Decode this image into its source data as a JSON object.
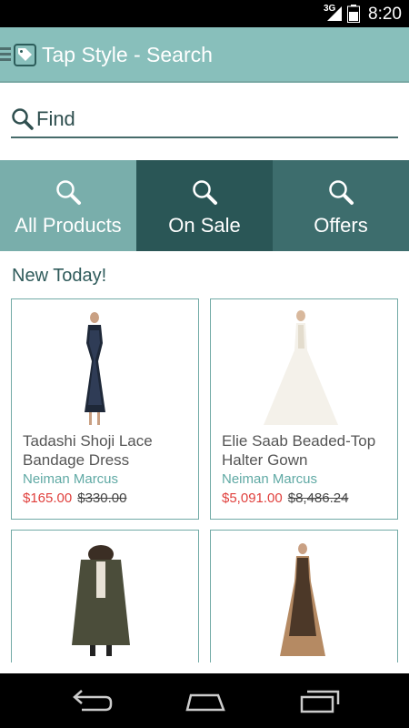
{
  "status_bar": {
    "network": "3G",
    "time": "8:20"
  },
  "app_bar": {
    "title": "Tap Style - Search"
  },
  "search": {
    "placeholder": "Find"
  },
  "tabs": [
    {
      "label": "All Products"
    },
    {
      "label": "On Sale"
    },
    {
      "label": "Offers"
    }
  ],
  "section_title": "New Today!",
  "products": [
    {
      "name": "Tadashi Shoji Lace Bandage Dress",
      "store": "Neiman Marcus",
      "sale_price": "$165.00",
      "original_price": "$330.00"
    },
    {
      "name": "Elie Saab Beaded-Top Halter Gown",
      "store": "Neiman Marcus",
      "sale_price": "$5,091.00",
      "original_price": "$8,486.24"
    },
    {
      "name": "",
      "store": "",
      "sale_price": "",
      "original_price": ""
    },
    {
      "name": "",
      "store": "",
      "sale_price": "",
      "original_price": ""
    }
  ],
  "colors": {
    "app_bar": "#88bfbb",
    "tab_all": "#79aeab",
    "tab_sale": "#2a5656",
    "tab_offers": "#3d6d6d",
    "sale_price": "#e0403d",
    "store": "#5fa9a4"
  },
  "icons": [
    "tag-logo-icon",
    "search-icon",
    "back-icon",
    "home-icon",
    "recents-icon"
  ]
}
